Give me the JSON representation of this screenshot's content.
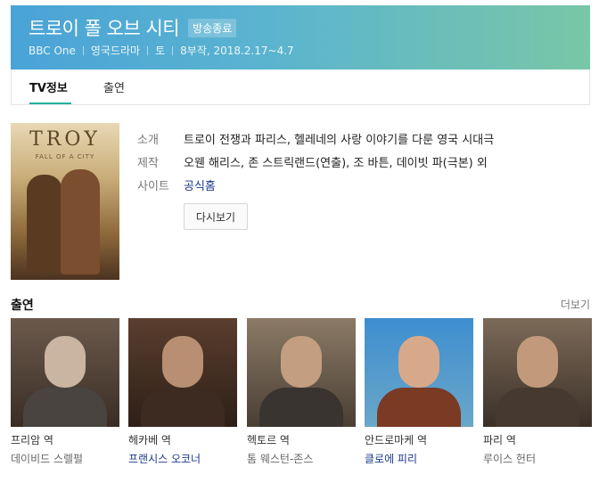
{
  "show": {
    "title": "트로이 폴 오브 시티",
    "status_badge": "방송종료",
    "meta": [
      "BBC One",
      "영국드라마",
      "토",
      "8부작, 2018.2.17~4.7"
    ]
  },
  "tabs": [
    {
      "label": "TV정보",
      "active": true
    },
    {
      "label": "출연",
      "active": false
    }
  ],
  "poster": {
    "title": "TROY",
    "subtitle": "FALL OF A CITY"
  },
  "info": {
    "rows": [
      {
        "label": "소개",
        "value": "트로이 전쟁과 파리스, 헬레네의 사랑 이야기를 다룬 영국 시대극"
      },
      {
        "label": "제작",
        "value": "오웬 해리스, 존 스트릭랜드(연출), 조 바튼, 데이빗 파(극본) 외"
      },
      {
        "label": "사이트",
        "value": "공식홈"
      }
    ],
    "rewatch_button": "다시보기"
  },
  "cast": {
    "heading": "출연",
    "more_link": "더보기",
    "items": [
      {
        "role": "프리암 역",
        "actor": "데이비드 스렐펄"
      },
      {
        "role": "헤카베 역",
        "actor": "프랜시스 오코너"
      },
      {
        "role": "헥토르 역",
        "actor": "톰 웨스턴-존스"
      },
      {
        "role": "안드로마케 역",
        "actor": "클로에 피리"
      },
      {
        "role": "파리 역",
        "actor": "루이스 헌터"
      }
    ]
  },
  "colors": {
    "header_start": "#4aa3d7",
    "header_end": "#79c7a6",
    "tab_accent": "#23b09e",
    "link": "#1a3a8a"
  }
}
